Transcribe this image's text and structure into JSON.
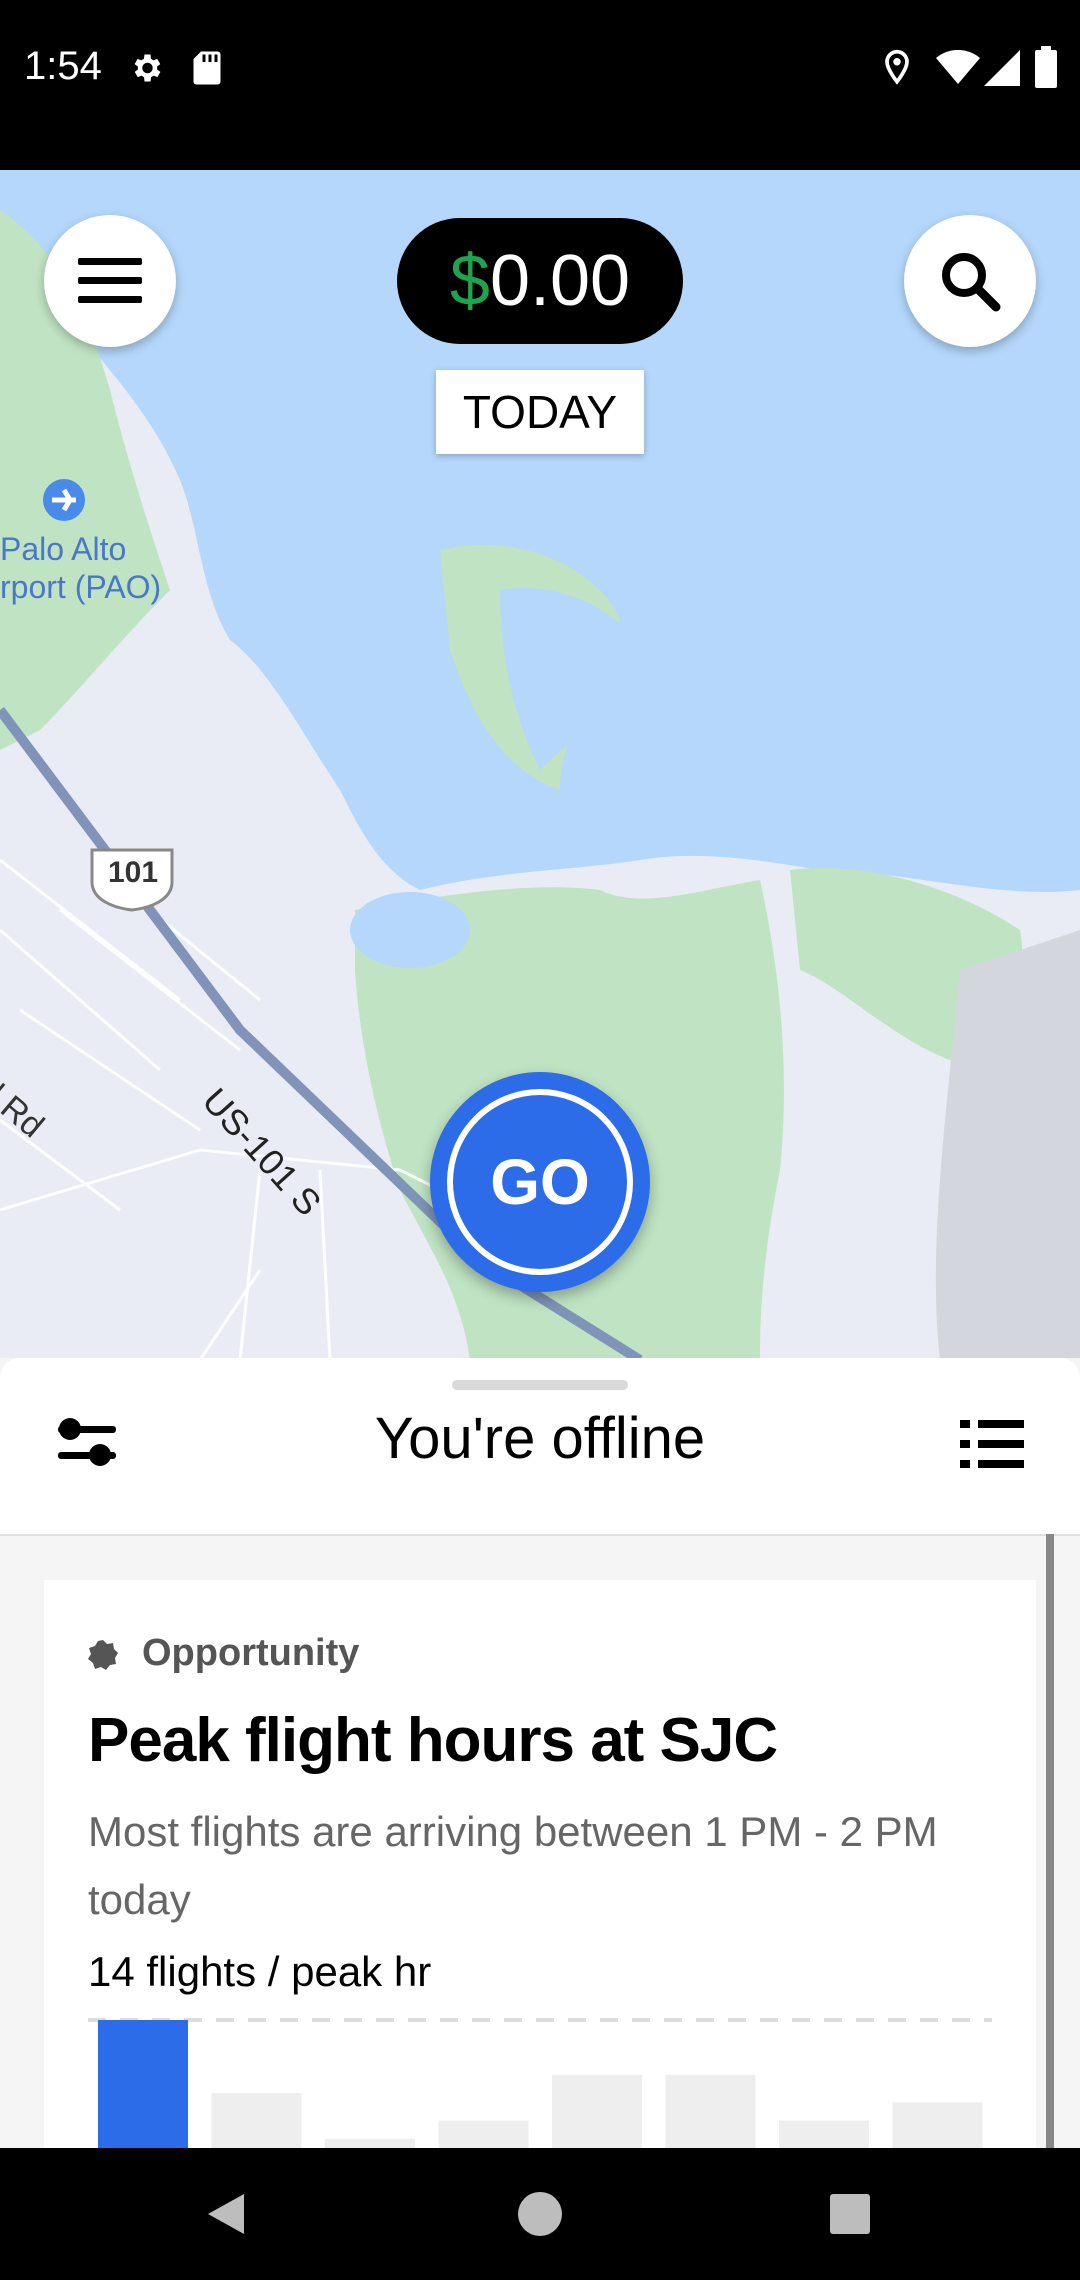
{
  "status_bar": {
    "time": "1:54",
    "icons": [
      "gear-icon",
      "sd-card-icon",
      "location-icon",
      "wifi-icon",
      "signal-icon",
      "battery-icon"
    ]
  },
  "map": {
    "labels": {
      "airport_line1": "Palo Alto",
      "airport_line2": "rport (PAO)",
      "highway_shield": "101",
      "highway_name": "US-101 S",
      "road_name": "d Rd"
    },
    "colors": {
      "water": "#b4d7fb",
      "park": "#bfe3c3",
      "land": "#e9ecf4",
      "highway": "#7f94b8"
    }
  },
  "top_controls": {
    "menu_icon": "hamburger-menu-icon",
    "search_icon": "search-icon",
    "earnings_symbol": "$",
    "earnings_amount": "0.00",
    "today_label": "TODAY"
  },
  "go_button": {
    "label": "GO",
    "color": "#2d6ce8"
  },
  "sheet": {
    "status_title": "You're offline",
    "filter_icon": "sliders-icon",
    "list_icon": "list-icon"
  },
  "card": {
    "category": "Opportunity",
    "title": "Peak flight hours at SJC",
    "description": "Most flights are arriving between 1 PM - 2 PM today",
    "metric": "14 flights / peak hr"
  },
  "chart_data": {
    "type": "bar",
    "categories": [],
    "values": [
      14,
      6,
      1,
      3,
      8,
      8,
      3,
      5
    ],
    "highlight_index": 0,
    "highlight_color": "#2d6ce8",
    "bar_color": "#eeeeee",
    "peak_line": "dashed",
    "ylim": [
      0,
      14
    ]
  },
  "nav_bar": {
    "icons": [
      "back-icon",
      "home-icon",
      "recents-icon"
    ]
  }
}
